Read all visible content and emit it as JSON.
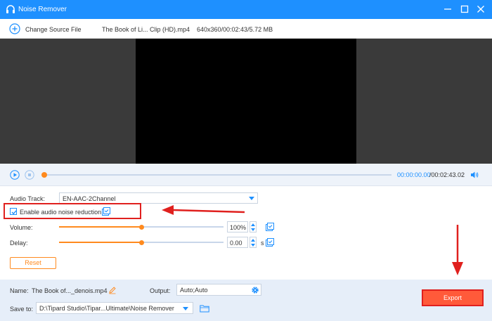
{
  "window": {
    "title": "Noise Remover"
  },
  "source": {
    "change_label": "Change Source File",
    "file_name": "The Book of Li... Clip (HD).mp4",
    "file_info": "640x360/00:02:43/5.72 MB"
  },
  "player": {
    "current_time": "00:00:00.00",
    "total_time": "/00:02:43.02",
    "progress": 0
  },
  "settings": {
    "audio_track_label": "Audio Track:",
    "audio_track_value": "EN-AAC-2Channel",
    "noise_reduction_label": "Enable audio noise reduction",
    "noise_reduction_checked": true,
    "volume_label": "Volume:",
    "volume_value": "100%",
    "volume_level": 0.5,
    "delay_label": "Delay:",
    "delay_value": "0.00",
    "delay_unit": "s",
    "delay_level": 0.5,
    "reset_label": "Reset"
  },
  "footer": {
    "name_label": "Name:",
    "name_value": "The Book of..._denois.mp4",
    "output_label": "Output:",
    "output_value": "Auto;Auto",
    "save_label": "Save to:",
    "save_path": "D:\\Tipard Studio\\Tipar...Ultimate\\Noise Remover",
    "export_label": "Export"
  },
  "colors": {
    "accent": "#1e90ff",
    "orange": "#ff8a1e",
    "export": "#ff5a3a",
    "annotation": "#e0201e"
  }
}
